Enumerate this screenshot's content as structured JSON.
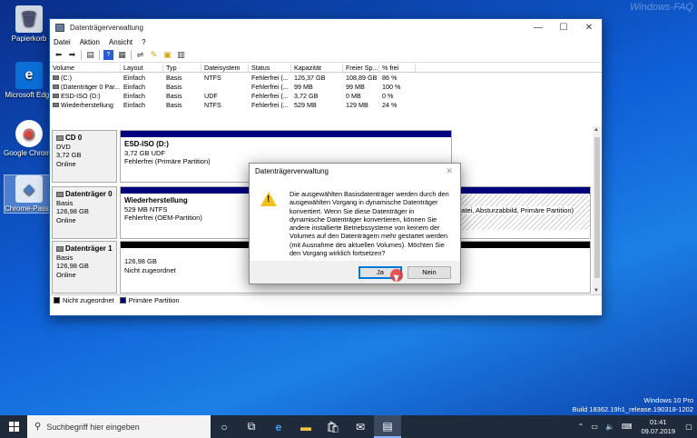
{
  "watermark": "Windows-FAQ",
  "desktop": {
    "icons": [
      {
        "label": "Papierkorb",
        "glyph": "🗑"
      },
      {
        "label": "Microsoft Edge",
        "glyph": "e"
      },
      {
        "label": "Google Chrome",
        "glyph": "◉"
      },
      {
        "label": "Chrome-Passwörter",
        "glyph": "◆"
      }
    ]
  },
  "window": {
    "title": "Datenträgerverwaltung",
    "controls": {
      "minimize": "—",
      "maximize": "☐",
      "close": "✕"
    },
    "menu": [
      "Datei",
      "Aktion",
      "Ansicht",
      "?"
    ],
    "toolbar_icons": [
      "back-icon",
      "forward-icon",
      "list-icon",
      "help-icon",
      "properties-icon",
      "connect-icon",
      "wizard-icon",
      "refresh-icon",
      "view-icon"
    ],
    "table": {
      "headers": [
        "Volume",
        "Layout",
        "Typ",
        "Dateisystem",
        "Status",
        "Kapazität",
        "Freier Sp...",
        "% frei"
      ],
      "rows": [
        [
          "(C:)",
          "Einfach",
          "Basis",
          "NTFS",
          "Fehlerfrei (...",
          "126,37 GB",
          "108,89 GB",
          "86 %"
        ],
        [
          "(Datenträger 0 Par...",
          "Einfach",
          "Basis",
          "",
          "Fehlerfrei (...",
          "99 MB",
          "99 MB",
          "100 %"
        ],
        [
          "ESD-ISO (D:)",
          "Einfach",
          "Basis",
          "UDF",
          "Fehlerfrei (...",
          "3,72 GB",
          "0 MB",
          "0 %"
        ],
        [
          "Wiederherstellung",
          "Einfach",
          "Basis",
          "NTFS",
          "Fehlerfrei (...",
          "529 MB",
          "129 MB",
          "24 %"
        ]
      ]
    },
    "disks": {
      "cd0": {
        "name": "CD 0",
        "type": "DVD",
        "size": "3,72 GB",
        "status": "Online",
        "part_name": "ESD-ISO  (D:)",
        "part_size": "3,72 GB UDF",
        "part_status": "Fehlerfrei (Primäre Partition)"
      },
      "disk0": {
        "name": "Datenträger 0",
        "type": "Basis",
        "size": "126,98 GB",
        "status": "Online",
        "part_name": "Wiederherstellung",
        "part_size": "529 MB NTFS",
        "part_status": "Fehlerfrei (OEM-Partition)",
        "part2_status": "datei, Absturzabbild, Primäre Partition)"
      },
      "disk1": {
        "name": "Datenträger 1",
        "type": "Basis",
        "size": "126,98 GB",
        "status": "Online",
        "part_size": "126,98 GB",
        "part_status": "Nicht zugeordnet"
      }
    },
    "legend": {
      "unallocated": "Nicht zugeordnet",
      "primary": "Primäre Partition",
      "unallocated_color": "#000000",
      "primary_color": "#00007f"
    }
  },
  "dialog": {
    "title": "Datenträgerverwaltung",
    "close": "✕",
    "message": "Die ausgewählten Basisdatenträger werden durch den ausgewählten Vorgang in dynamische Datenträger konvertiert. Wenn Sie diese Datenträger in dynamische Datenträger konvertieren, können Sie andere installierte Betriebssysteme von keinem der Volumes auf den Datenträgern mehr gestartet werden (mit Ausnahme des aktuellen Volumes). Möchten Sie den Vorgang wirklich fortsetzen?",
    "yes": "Ja",
    "no": "Nein"
  },
  "build": {
    "line1": "Windows 10 Pro",
    "line2": "Build 18362.19h1_release.190318-1202"
  },
  "taskbar": {
    "search_placeholder": "Suchbegriff hier eingeben",
    "time": "01:41",
    "date": "09.07.2019"
  }
}
